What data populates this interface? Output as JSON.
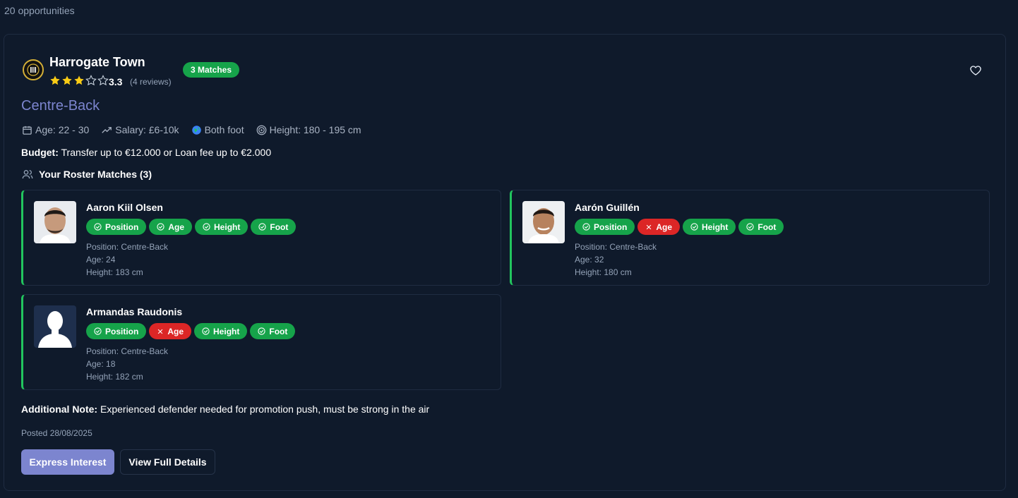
{
  "opportunities_count": "20 opportunities",
  "club": {
    "name": "Harrogate Town",
    "rating": "3.3",
    "reviews": "(4 reviews)",
    "stars_filled": 3,
    "stars_total": 5,
    "matches_badge": "3 Matches"
  },
  "position_title": "Centre-Back",
  "meta": {
    "age": "Age: 22 - 30",
    "salary": "Salary: £6-10k",
    "foot": "Both foot",
    "height": "Height: 180 - 195 cm"
  },
  "budget": {
    "label": "Budget:",
    "text": " Transfer up to €12.000 or Loan fee up to €2.000"
  },
  "roster_title": "Your Roster Matches (3)",
  "players": [
    {
      "name": "Aaron Kiil Olsen",
      "tags": [
        {
          "label": "Position",
          "ok": true
        },
        {
          "label": "Age",
          "ok": true
        },
        {
          "label": "Height",
          "ok": true
        },
        {
          "label": "Foot",
          "ok": true
        }
      ],
      "position": "Position: Centre-Back",
      "age": "Age: 24",
      "height": "Height: 183 cm"
    },
    {
      "name": "Aarón Guillén",
      "tags": [
        {
          "label": "Position",
          "ok": true
        },
        {
          "label": "Age",
          "ok": false
        },
        {
          "label": "Height",
          "ok": true
        },
        {
          "label": "Foot",
          "ok": true
        }
      ],
      "position": "Position: Centre-Back",
      "age": "Age: 32",
      "height": "Height: 180 cm"
    },
    {
      "name": "Armandas Raudonis",
      "tags": [
        {
          "label": "Position",
          "ok": true
        },
        {
          "label": "Age",
          "ok": false
        },
        {
          "label": "Height",
          "ok": true
        },
        {
          "label": "Foot",
          "ok": true
        }
      ],
      "position": "Position: Centre-Back",
      "age": "Age: 18",
      "height": "Height: 182 cm"
    }
  ],
  "note": {
    "label": "Additional Note:",
    "text": " Experienced defender needed for promotion push, must be strong in the air"
  },
  "posted": "Posted 28/08/2025",
  "buttons": {
    "express": "Express Interest",
    "details": "View Full Details"
  },
  "colors": {
    "accent": "#7c85cf",
    "match_ok": "#16a34a",
    "match_bad": "#dc2626",
    "background": "#0f1a2b"
  }
}
